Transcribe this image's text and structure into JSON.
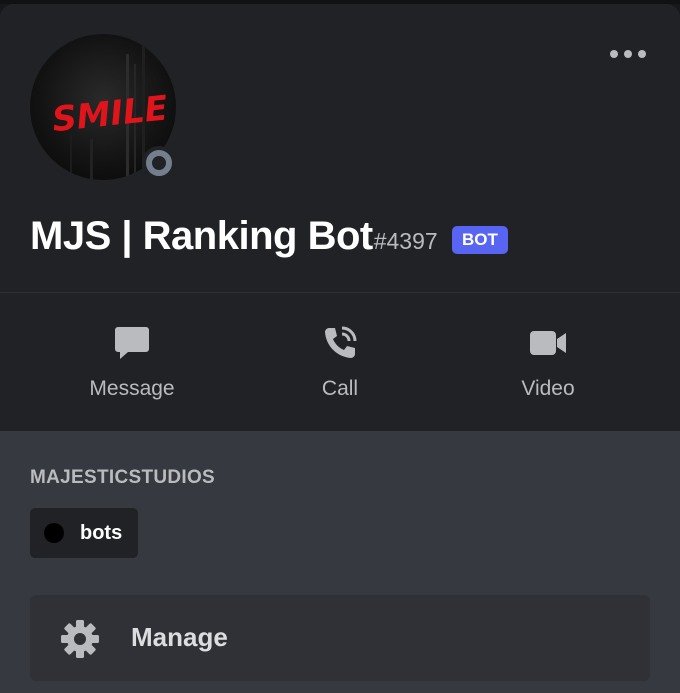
{
  "profile": {
    "avatar_text": "SMILE",
    "username": "MJS | Ranking Bot",
    "discriminator": "#4397",
    "badge": "BOT",
    "status": "offline"
  },
  "actions": [
    {
      "label": "Message",
      "icon": "message-icon"
    },
    {
      "label": "Call",
      "icon": "phone-icon"
    },
    {
      "label": "Video",
      "icon": "video-camera-icon"
    }
  ],
  "server": {
    "name": "MAJESTICSTUDIOS",
    "roles": [
      {
        "label": "bots",
        "color": "#000000"
      }
    ]
  },
  "manage": {
    "label": "Manage",
    "icon": "gear-icon"
  },
  "colors": {
    "badge": "#5865f2",
    "avatar_text": "#e0141b",
    "status_offline": "#747f8d"
  }
}
